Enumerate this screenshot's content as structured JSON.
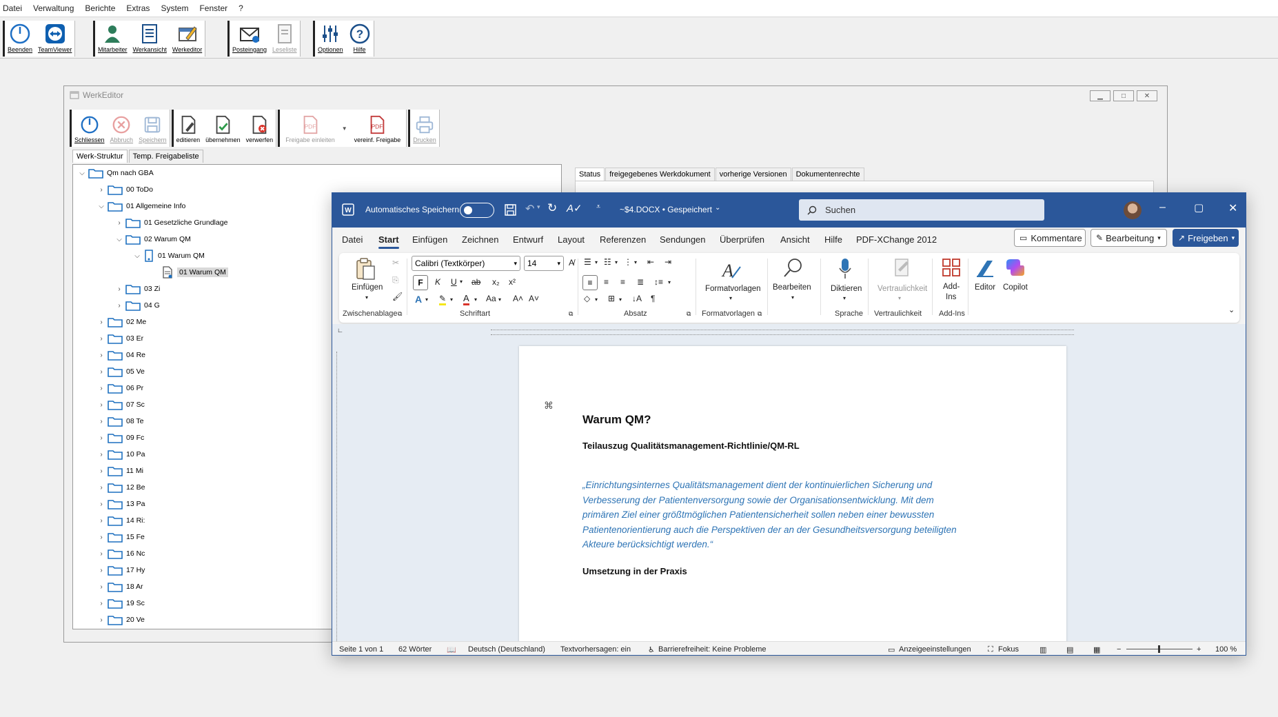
{
  "app": {
    "menu": [
      "Datei",
      "Verwaltung",
      "Berichte",
      "Extras",
      "System",
      "Fenster",
      "?"
    ],
    "toolbar": {
      "beenden": "Beenden",
      "teamviewer": "TeamViewer",
      "mitarbeiter": "Mitarbeiter",
      "werkansicht": "Werkansicht",
      "werkeditor": "Werkeditor",
      "posteingang": "Posteingang",
      "leseliste": "Leseliste",
      "optionen": "Optionen",
      "hilfe": "Hilfe"
    }
  },
  "werkeditor": {
    "title": "WerkEditor",
    "toolbar": {
      "schliessen": "Schliessen",
      "abbruch": "Abbruch",
      "speichern": "Speichern",
      "editieren": "editieren",
      "uebernehmen": "übernehmen",
      "verwerfen": "verwerfen",
      "freigabe_einleiten": "Freigabe einleiten",
      "vereinf_freigabe": "vereinf. Freigabe",
      "drucken": "Drucken"
    },
    "tabs": [
      "Werk-Struktur",
      "Temp. Freigabeliste"
    ],
    "right_tabs": [
      "Status",
      "freigegebenes Werkdokument",
      "vorherige Versionen",
      "Dokumentenrechte"
    ],
    "tree": {
      "root": "Qm nach GBA",
      "n00": "00 ToDo",
      "n01": "01 Allgemeine Info",
      "n01_01": "01 Gesetzliche Grundlage",
      "n01_02": "02 Warum QM",
      "n01_02_01": "01 Warum QM",
      "n01_02_01_doc": "01 Warum QM",
      "n01_03": "03 Zi",
      "n01_04": "04 G",
      "rest": [
        "02 Me",
        "03 Er",
        "04 Re",
        "05 Ve",
        "06 Pr",
        "07 Sc",
        "08 Te",
        "09 Fc",
        "10 Pa",
        "11 Mi",
        "12 Be",
        "13 Pa",
        "14 Ri:",
        "15 Fe",
        "16 Nc",
        "17 Hy",
        "18 Ar",
        "19 Sc",
        "20 Ve"
      ]
    }
  },
  "word": {
    "autosave_label": "Automatisches Speichern",
    "doc_title": "~$4.DOCX • Gespeichert",
    "search_placeholder": "Suchen",
    "menu": [
      "Datei",
      "Start",
      "Einfügen",
      "Zeichnen",
      "Entwurf",
      "Layout",
      "Referenzen",
      "Sendungen",
      "Überprüfen",
      "Ansicht",
      "Hilfe",
      "PDF-XChange 2012"
    ],
    "comments_btn": "Kommentare",
    "edit_btn": "Bearbeitung",
    "share_btn": "Freigeben",
    "ribbon": {
      "einfuegen": "Einfügen",
      "zwischenablage": "Zwischenablage",
      "font_name": "Calibri (Textkörper)",
      "font_size": "14",
      "schriftart": "Schriftart",
      "absatz": "Absatz",
      "formatvorlagen": "Formatvorlagen",
      "formatvorlagen_group": "Formatvorlagen",
      "bearbeiten": "Bearbeiten",
      "diktieren": "Diktieren",
      "sprache": "Sprache",
      "vertraulichkeit": "Vertraulichkeit",
      "vertraulichkeit_group": "Vertraulichkeit",
      "addins_1": "Add-",
      "addins_2": "Ins",
      "addins_group": "Add-Ins",
      "editor": "Editor",
      "copilot": "Copilot",
      "bold": "F",
      "italic": "K",
      "underline": "U",
      "strike": "ab",
      "sub": "x₂",
      "sup": "x²",
      "case": "Aa"
    },
    "document": {
      "heading": "Warum QM?",
      "subheading": "Teilauszug Qualitätsmanagement-Richtlinie/QM-RL",
      "quote_lines": [
        "„Einrichtungsinternes Qualitätsmanagement dient der kontinuierlichen Sicherung und",
        "Verbesserung der Patientenversorgung sowie der Organisationsentwicklung. Mit dem",
        "primären Ziel einer größtmöglichen Patientensicherheit sollen neben einer bewussten",
        "Patientenorientierung auch die Perspektiven der an der Gesundheitsversorgung beteiligten",
        "Akteure berücksichtigt werden.“"
      ],
      "heading2": "Umsetzung in der Praxis"
    },
    "status": {
      "page": "Seite 1 von 1",
      "words": "62 Wörter",
      "lang": "Deutsch (Deutschland)",
      "predict": "Textvorhersagen: ein",
      "access": "Barrierefreiheit: Keine Probleme",
      "display": "Anzeigeeinstellungen",
      "focus": "Fokus",
      "zoom": "100 %"
    }
  }
}
